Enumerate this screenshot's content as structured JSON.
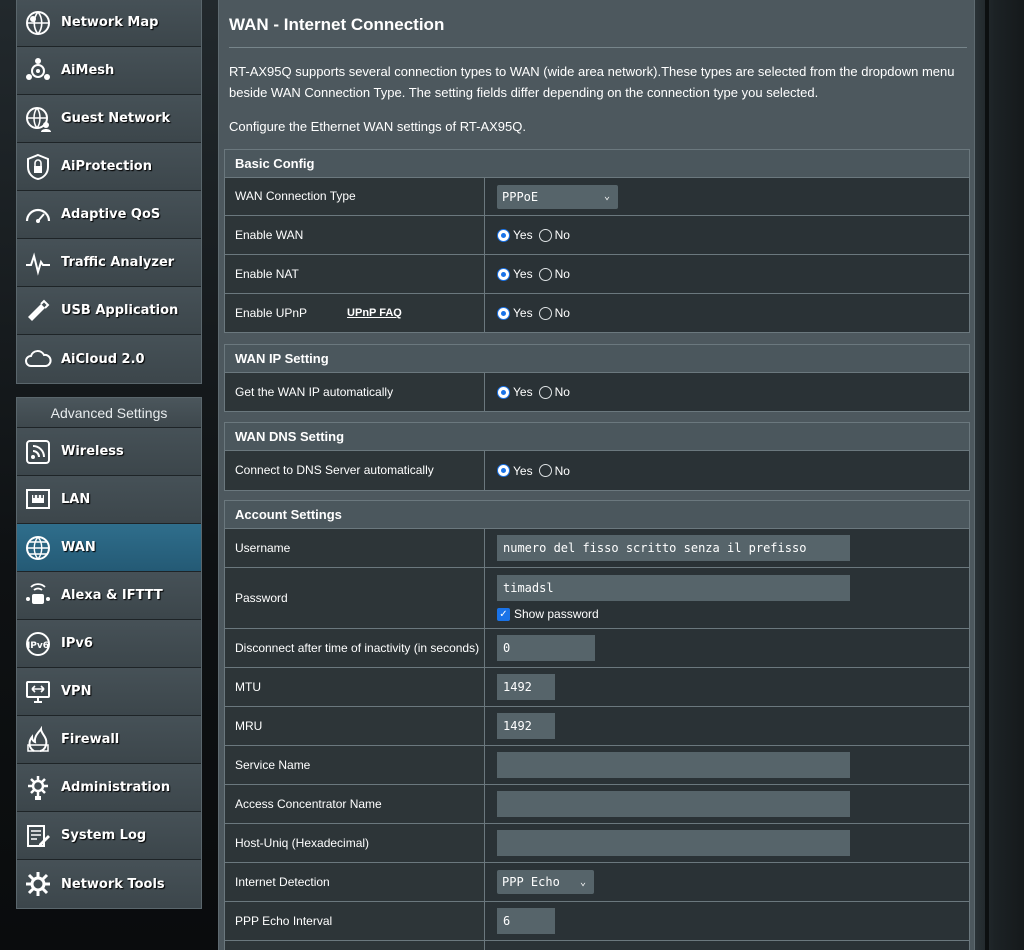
{
  "sidebar": {
    "general_items": [
      {
        "label": "Network Map",
        "icon": "network-map-icon"
      },
      {
        "label": "AiMesh",
        "icon": "aimesh-icon"
      },
      {
        "label": "Guest Network",
        "icon": "guest-network-icon"
      },
      {
        "label": "AiProtection",
        "icon": "aiprotection-icon"
      },
      {
        "label": "Adaptive QoS",
        "icon": "adaptive-qos-icon"
      },
      {
        "label": "Traffic Analyzer",
        "icon": "traffic-analyzer-icon"
      },
      {
        "label": "USB Application",
        "icon": "usb-application-icon"
      },
      {
        "label": "AiCloud 2.0",
        "icon": "aicloud-icon"
      }
    ],
    "advanced_header": "Advanced Settings",
    "advanced_items": [
      {
        "label": "Wireless",
        "icon": "wireless-icon"
      },
      {
        "label": "LAN",
        "icon": "lan-icon"
      },
      {
        "label": "WAN",
        "icon": "wan-icon",
        "active": true
      },
      {
        "label": "Alexa & IFTTT",
        "icon": "alexa-icon"
      },
      {
        "label": "IPv6",
        "icon": "ipv6-icon"
      },
      {
        "label": "VPN",
        "icon": "vpn-icon"
      },
      {
        "label": "Firewall",
        "icon": "firewall-icon"
      },
      {
        "label": "Administration",
        "icon": "administration-icon"
      },
      {
        "label": "System Log",
        "icon": "system-log-icon"
      },
      {
        "label": "Network Tools",
        "icon": "network-tools-icon"
      }
    ]
  },
  "main": {
    "title": "WAN - Internet Connection",
    "description": "RT-AX95Q supports several connection types to WAN (wide area network).These types are selected from the dropdown menu beside WAN Connection Type. The setting fields differ depending on the connection type you selected.",
    "description2": "Configure the Ethernet WAN settings of RT-AX95Q."
  },
  "basic_config": {
    "header": "Basic Config",
    "wan_type_label": "WAN Connection Type",
    "wan_type_value": "PPPoE",
    "enable_wan_label": "Enable WAN",
    "enable_nat_label": "Enable NAT",
    "enable_upnp_label": "Enable UPnP",
    "upnp_faq": "UPnP  FAQ"
  },
  "radio": {
    "yes": "Yes",
    "no": "No"
  },
  "wan_ip": {
    "header": "WAN IP Setting",
    "auto_label": "Get the WAN IP automatically"
  },
  "wan_dns": {
    "header": "WAN DNS Setting",
    "auto_label": "Connect to DNS Server automatically"
  },
  "account": {
    "header": "Account Settings",
    "username_label": "Username",
    "username_value": "numero del fisso scritto senza il prefisso",
    "password_label": "Password",
    "password_value": "timadsl",
    "show_password": "Show password",
    "disconnect_label": "Disconnect after time of inactivity (in seconds)",
    "disconnect_value": "0",
    "mtu_label": "MTU",
    "mtu_value": "1492",
    "mru_label": "MRU",
    "mru_value": "1492",
    "service_name_label": "Service Name",
    "service_name_value": "",
    "ac_name_label": "Access Concentrator Name",
    "ac_name_value": "",
    "host_uniq_label": "Host-Uniq (Hexadecimal)",
    "host_uniq_value": "",
    "detection_label": "Internet Detection",
    "detection_value": "PPP Echo",
    "echo_interval_label": "PPP Echo Interval",
    "echo_interval_value": "6"
  },
  "colors": {
    "active_menu": "#2f6e8c",
    "radio_accent": "#1a73e8",
    "panel": "#4d585e"
  }
}
